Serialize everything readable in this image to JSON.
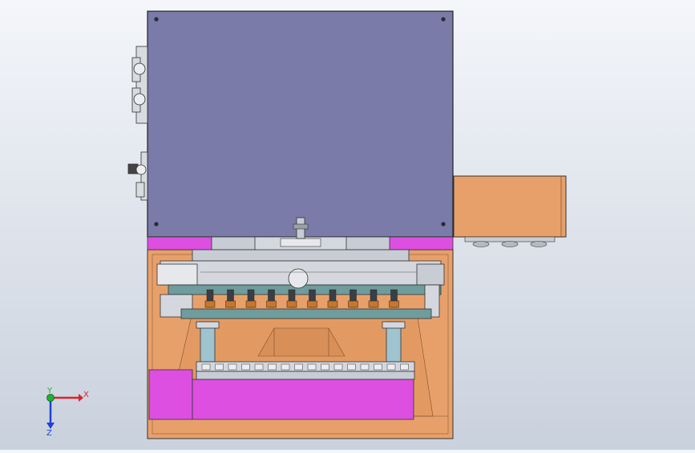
{
  "triad": {
    "x_label": "X",
    "y_label": "Y",
    "z_label": "Z"
  },
  "colors": {
    "background_top": "#f4f6fa",
    "background_bottom": "#c9d1dd",
    "top_plate": "#7a7ba8",
    "orange_body": "#e8a06a",
    "magenta": "#dc4fe0",
    "steel": "#c8ccd4",
    "teal": "#6f9c9c",
    "cylinder": "#9fc3cf",
    "triad_x": "#e0202a",
    "triad_y": "#20b030",
    "triad_z": "#2040d8"
  }
}
